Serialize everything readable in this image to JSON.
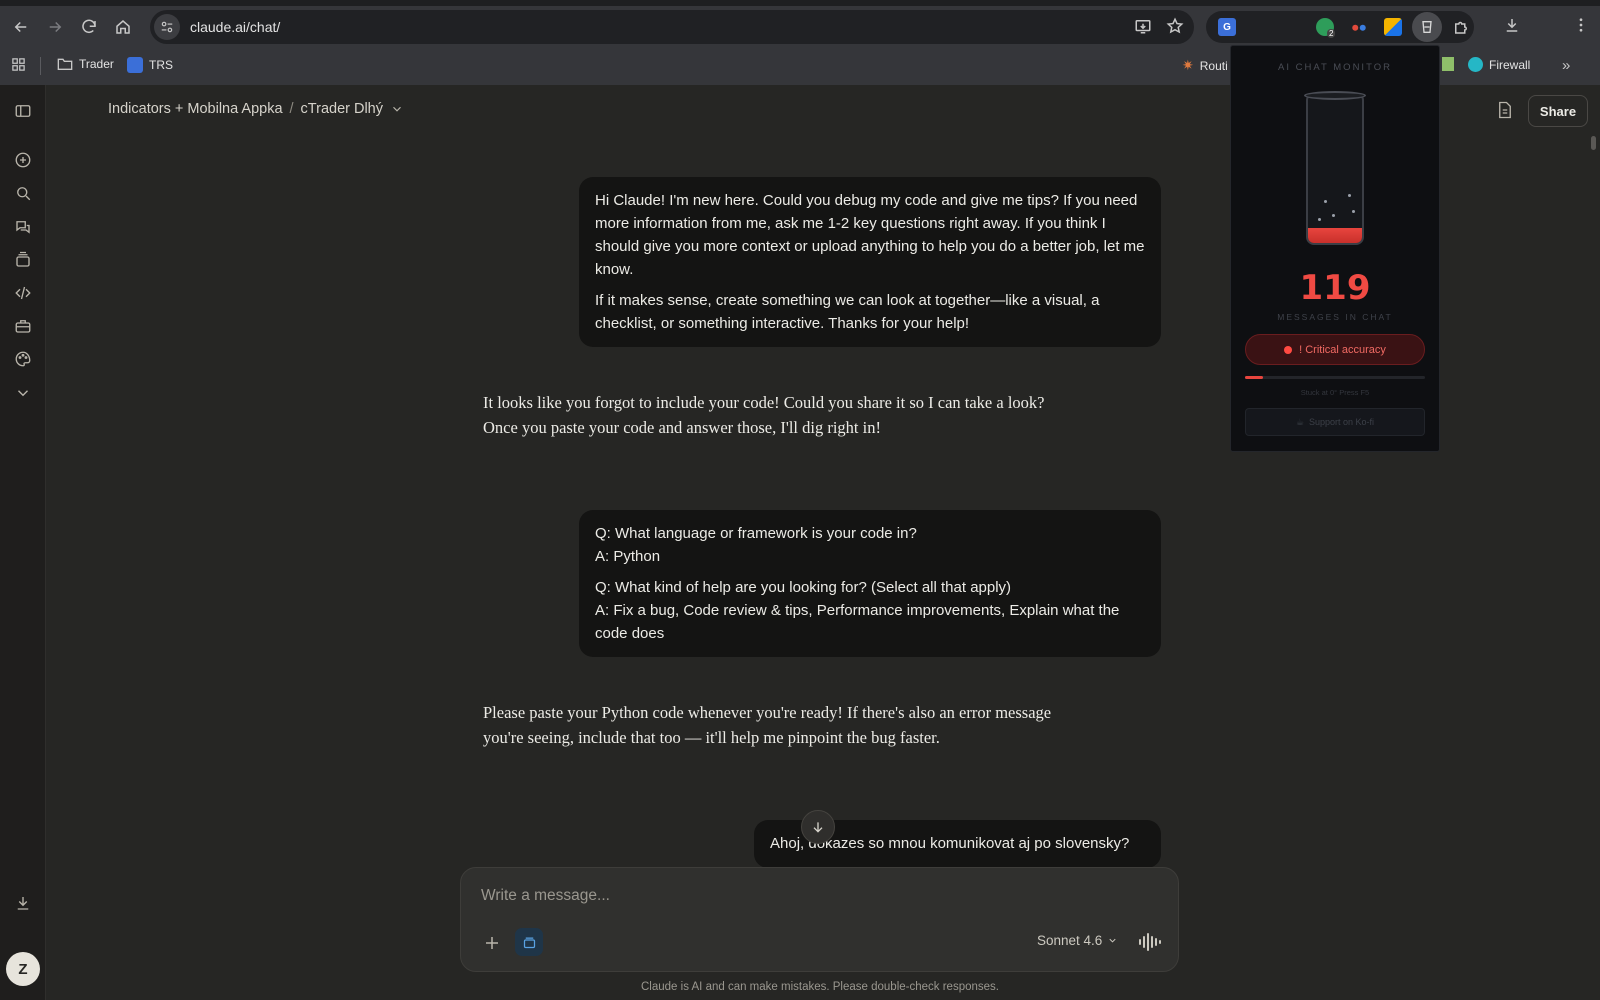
{
  "browser": {
    "url": "claude.ai/chat/",
    "bookmarks": [
      {
        "label": "Trader"
      },
      {
        "label": "TRS"
      },
      {
        "label": "Routi"
      },
      {
        "label": "Firewall"
      }
    ],
    "extension_badge": "2"
  },
  "header": {
    "project": "Indicators + Mobilna Appka",
    "separator": "/",
    "chat_title": "cTrader Dlhý",
    "share_label": "Share"
  },
  "messages": [
    {
      "role": "user",
      "paragraphs": [
        "Hi Claude! I'm new here. Could you debug my code and give me tips? If you need more information from me, ask me 1-2 key questions right away. If you think I should give you more context or upload anything to help you do a better job, let me know.",
        "If it makes sense, create something we can look at together—like a visual, a checklist, or something interactive. Thanks for your help!"
      ]
    },
    {
      "role": "assistant",
      "lines": [
        "It looks like you forgot to include your code! Could you share it so I can take a look?",
        "Once you paste your code and answer those, I'll dig right in!"
      ]
    },
    {
      "role": "user",
      "lines": [
        "Q: What language or framework is your code in?",
        "A: Python",
        "Q: What kind of help are you looking for? (Select all that apply)",
        "A: Fix a bug, Code review & tips, Performance improvements, Explain what the code does"
      ]
    },
    {
      "role": "assistant",
      "lines": [
        "Please paste your Python code whenever you're ready! If there's also an error message",
        "you're seeing, include that too — it'll help me pinpoint the bug faster."
      ]
    },
    {
      "role": "user",
      "text": "Ahoj, dokazes so mnou komunikovat aj po slovensky?"
    }
  ],
  "composer": {
    "placeholder": "Write a message...",
    "model": "Sonnet 4.6"
  },
  "disclaimer": "Claude is AI and can make mistakes. Please double-check responses.",
  "user_initial": "Z",
  "extension_popup": {
    "title": "AI CHAT MONITOR",
    "count": "119",
    "count_label": "MESSAGES IN CHAT",
    "status": "! Critical accuracy",
    "status_color": "#f04a43",
    "accuracy_level": 0.1,
    "note": "Stuck at 0° Press F5",
    "support": "Support on Ko-fi"
  }
}
